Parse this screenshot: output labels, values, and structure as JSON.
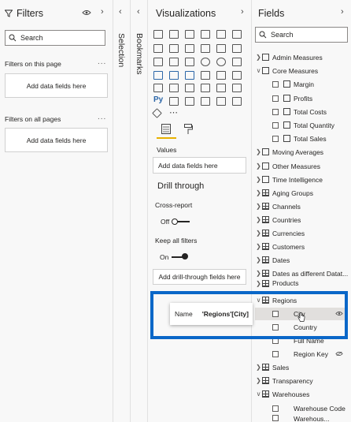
{
  "filters": {
    "title": "Filters",
    "search_placeholder": "Search",
    "on_this_page": "Filters on this page",
    "on_all_pages": "Filters on all pages",
    "add_fields": "Add data fields here",
    "ellipsis": "..."
  },
  "strips": {
    "selection": "Selection",
    "bookmarks": "Bookmarks"
  },
  "viz": {
    "title": "Visualizations",
    "values_label": "Values",
    "add_fields": "Add data fields here",
    "drill_through": "Drill through",
    "cross_report": "Cross-report",
    "off": "Off",
    "keep_all_filters": "Keep all filters",
    "on": "On",
    "add_drill": "Add drill-through fields here",
    "icon_letters": {
      "py": "Py"
    }
  },
  "fields": {
    "title": "Fields",
    "search_placeholder": "Search",
    "tables": [
      {
        "name": "Admin Measures",
        "expanded": false
      },
      {
        "name": "Core Measures",
        "expanded": true
      },
      {
        "name": "Moving Averages",
        "expanded": false
      },
      {
        "name": "Other Measures",
        "expanded": false
      },
      {
        "name": "Time Intelligence",
        "expanded": false
      },
      {
        "name": "Aging Groups",
        "expanded": false
      },
      {
        "name": "Channels",
        "expanded": false
      },
      {
        "name": "Countries",
        "expanded": false
      },
      {
        "name": "Currencies",
        "expanded": false
      },
      {
        "name": "Customers",
        "expanded": false
      },
      {
        "name": "Dates",
        "expanded": false
      },
      {
        "name": "Dates as different Datat...",
        "expanded": false
      },
      {
        "name": "Products",
        "expanded": false
      },
      {
        "name": "Regions",
        "expanded": true
      },
      {
        "name": "Sales",
        "expanded": false
      },
      {
        "name": "Transparency",
        "expanded": false
      },
      {
        "name": "Warehouses",
        "expanded": true
      }
    ],
    "core_measures": [
      "Margin",
      "Profits",
      "Total Costs",
      "Total Quantity",
      "Total Sales"
    ],
    "regions_fields": [
      "City",
      "Country",
      "Full Name",
      "Region Key"
    ],
    "warehouses_fields": [
      "Warehouse Code",
      "Warehous..."
    ]
  },
  "tooltip": {
    "label": "Name",
    "value": "'Regions'[City]"
  },
  "colors": {
    "highlight": "#0a67c8",
    "accent": "#e8b100"
  }
}
